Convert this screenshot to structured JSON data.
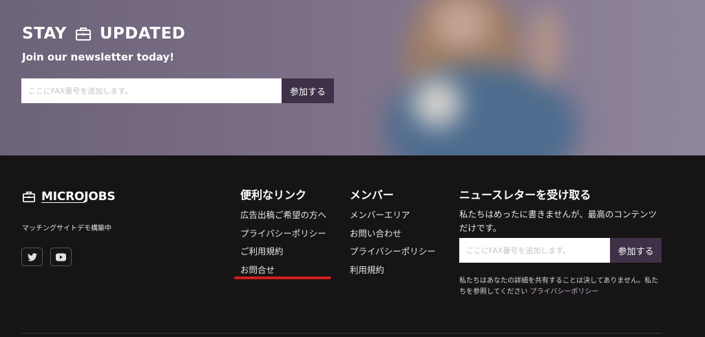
{
  "hero": {
    "title_left": "STAY",
    "title_right": "UPDATED",
    "title_icon": "briefcase-icon",
    "subtitle": "Join our newsletter today!",
    "input_placeholder": "ここにFAX番号を追加します。",
    "submit_label": "参加する"
  },
  "footer": {
    "logo": {
      "icon": "briefcase-icon",
      "text_underlined": "MICRO",
      "text_rest": "JOBS"
    },
    "tagline": "マッチングサイトデモ構築中",
    "socials": [
      {
        "icon": "twitter-icon"
      },
      {
        "icon": "youtube-icon"
      }
    ],
    "links": {
      "heading": "便利なリンク",
      "items": [
        "広告出稿ご希望の方へ",
        "プライバシーポリシー",
        "ご利用規約",
        "お問合せ"
      ]
    },
    "member": {
      "heading": "メンバー",
      "items": [
        "メンバーエリア",
        "お問い合わせ",
        "プライバシーポリシー",
        "利用規約"
      ]
    },
    "newsletter": {
      "heading": "ニュースレターを受け取る",
      "description": "私たちはめったに書きませんが、最高のコンテンツだけです。",
      "input_placeholder": "ここにFAX番号を追加します。",
      "submit_label": "参加する",
      "privacy_text": "私たちはあなたの詳細を共有することは決してありません。私たちを参照してください",
      "privacy_link": "プライバシーポリシー"
    }
  },
  "colors": {
    "accent_button": "#3e3148",
    "footer_bg": "#161415",
    "highlight_underline": "#d11d1d"
  }
}
